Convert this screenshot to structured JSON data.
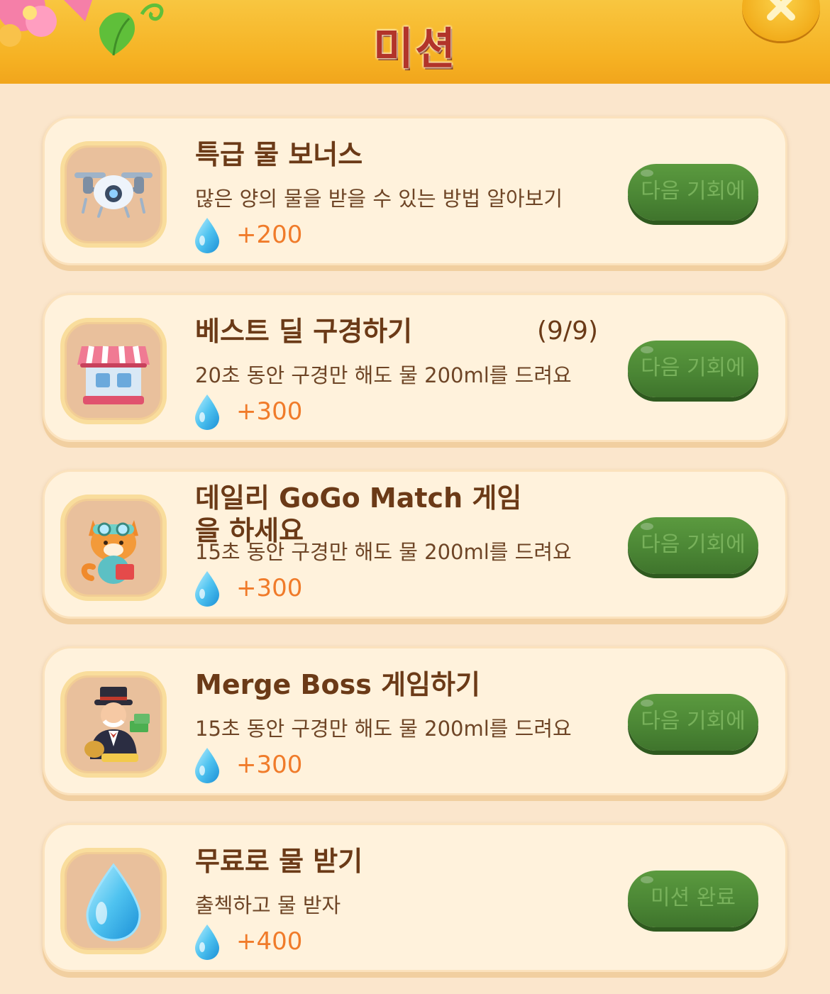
{
  "header": {
    "title": "미션"
  },
  "missions": [
    {
      "title": "특급 물 보너스",
      "progress": "",
      "description": "많은 양의 물을 받을 수 있는 방법 알아보기",
      "reward": "+200",
      "button": "다음 기회에",
      "icon": "drone-icon"
    },
    {
      "title": "베스트 딜 구경하기",
      "progress": "(9/9)",
      "description": "20초 동안 구경만 해도 물 200ml를 드려요",
      "reward": "+300",
      "button": "다음 기회에",
      "icon": "shop-icon"
    },
    {
      "title": "데일리 GoGo Match 게임을 하세요",
      "progress": "",
      "description": "15초 동안 구경만 해도 물 200ml를 드려요",
      "reward": "+300",
      "button": "다음 기회에",
      "icon": "fox-character-icon"
    },
    {
      "title": "Merge Boss 게임하기",
      "progress": "",
      "description": "15초 동안 구경만 해도 물 200ml를 드려요",
      "reward": "+300",
      "button": "다음 기회에",
      "icon": "boss-character-icon"
    },
    {
      "title": "무료로 물 받기",
      "progress": "",
      "description": "출첵하고 물 받자",
      "reward": "+400",
      "button": "미션 완료",
      "icon": "water-drop-icon"
    }
  ],
  "colors": {
    "header": "#f6b223",
    "title": "#b2342a",
    "card": "#fff2dc",
    "button": "#4a8534",
    "reward": "#f07b2a"
  }
}
